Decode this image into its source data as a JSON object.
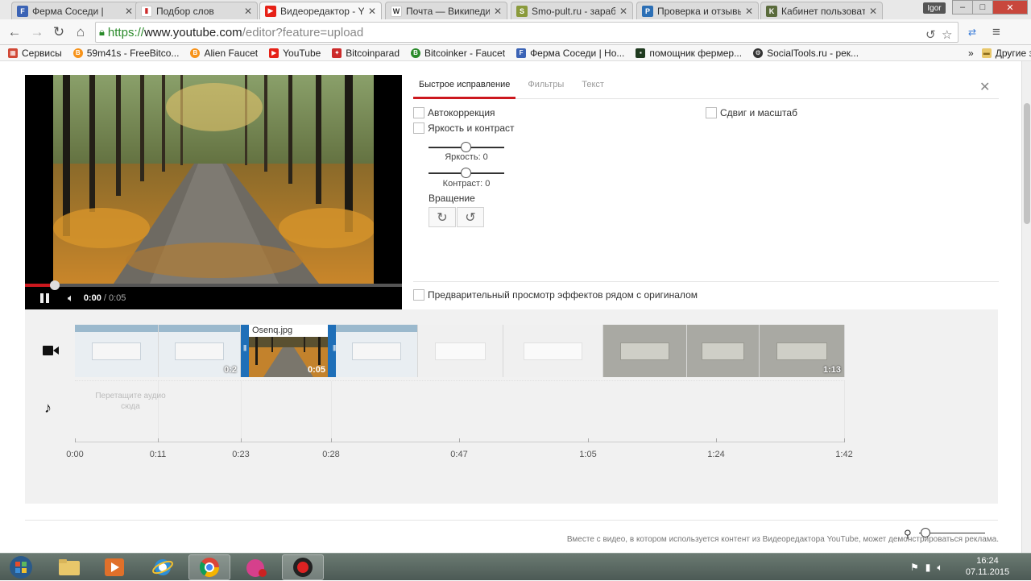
{
  "browser": {
    "tabs": [
      {
        "label": "Ферма Соседи |",
        "favicon": "F",
        "color": "#3b63b5"
      },
      {
        "label": "Подбор слов",
        "favicon": "▮",
        "color": "#cc2a2a"
      },
      {
        "label": "Видеоредактор - Yo",
        "favicon": "▶",
        "color": "#e62117",
        "active": true
      },
      {
        "label": "Почта — Википедия",
        "favicon": "W",
        "color": "#555555"
      },
      {
        "label": "Smo-pult.ru - зараб",
        "favicon": "S",
        "color": "#8a9a3b"
      },
      {
        "label": "Проверка и отзывы",
        "favicon": "P",
        "color": "#2c6fb5"
      },
      {
        "label": "Кабинет пользовате",
        "favicon": "K",
        "color": "#5a6b3c"
      }
    ],
    "user_badge": "Igor",
    "window_controls": {
      "minimize": "–",
      "maximize": "□",
      "close": "✕"
    },
    "url_scheme": "https://",
    "url_host": "www.youtube.com",
    "url_rest": "/editor?feature=upload",
    "bookmarks": [
      {
        "label": "Сервисы",
        "color": "#d14836"
      },
      {
        "label": "59m41s - FreeBitco...",
        "color": "#f7931a"
      },
      {
        "label": "Alien Faucet",
        "color": "#f7931a"
      },
      {
        "label": "YouTube",
        "color": "#e62117"
      },
      {
        "label": "Bitcoinparad",
        "color": "#cc2a2a"
      },
      {
        "label": "Bitcoinker - Faucet",
        "color": "#2a8a2a"
      },
      {
        "label": "Ферма Соседи | Но...",
        "color": "#3b63b5"
      },
      {
        "label": "помощник фермер...",
        "color": "#1f3a1f"
      },
      {
        "label": "SocialTools.ru - рек...",
        "color": "#333333"
      }
    ],
    "bookmarks_more": "»",
    "other_bookmarks": "Другие закладки"
  },
  "player": {
    "time_current": "0:00",
    "time_total": "/ 0:05",
    "progress_fraction": 0.08
  },
  "editor": {
    "tabs": [
      "Быстрое исправление",
      "Фильтры",
      "Текст"
    ],
    "active_tab": 0,
    "close": "✕",
    "autocorrect": "Автокоррекция",
    "brightness_contrast": "Яркость и контраст",
    "pan_zoom": "Сдвиг и масштаб",
    "brightness_label": "Яркость: 0",
    "contrast_label": "Контраст: 0",
    "rotation_label": "Вращение",
    "rotate_right": "↻",
    "rotate_left": "↺",
    "preview_side_by_side": "Предварительный просмотр эффектов рядом с оригиналом"
  },
  "timeline": {
    "selected_clip_name": "Osenq.jpg",
    "selected_clip_duration": "0:05",
    "clip_left_duration": "0:2",
    "clip_end_duration": "1:13",
    "audio_drop_hint": "Перетащите аудио сюда",
    "ticks": [
      "0:00",
      "0:11",
      "0:23",
      "0:28",
      "0:47",
      "1:05",
      "1:24",
      "1:42"
    ],
    "zoom_fraction": 0.1
  },
  "footer_note": "Вместе с видео, в котором используется контент из Видеоредактора YouTube, может демонстрироваться реклама.",
  "taskbar": {
    "clock_time": "16:24",
    "clock_date": "07.11.2015"
  }
}
